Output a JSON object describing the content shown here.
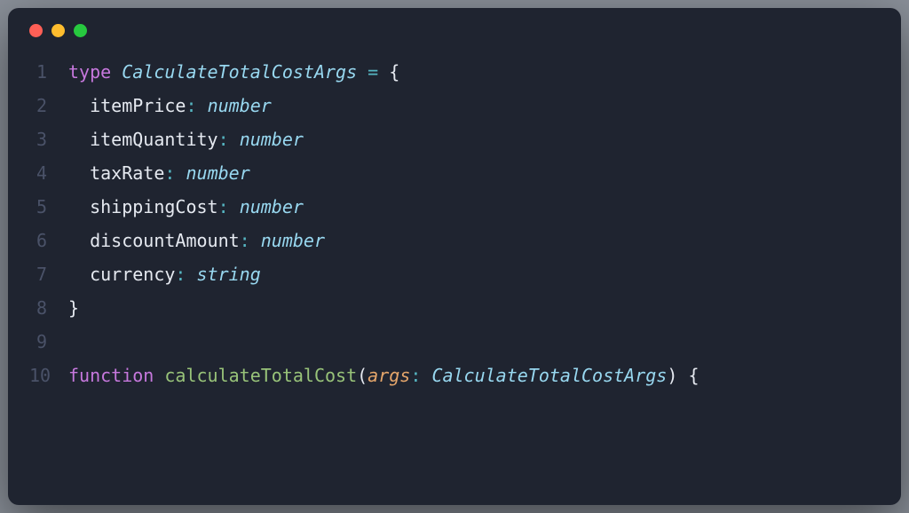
{
  "code": {
    "kw_type": "type",
    "type_name": "CalculateTotalCostArgs",
    "eq": " = ",
    "lbrace": "{",
    "rbrace": "}",
    "colon": ":",
    "comma": ",",
    "lparen": "(",
    "rparen": ")",
    "kw_function": "function",
    "fn_name": "calculateTotalCost",
    "param_name": "args",
    "props": {
      "p1": "itemPrice",
      "p2": "itemQuantity",
      "p3": "taxRate",
      "p4": "shippingCost",
      "p5": "discountAmount",
      "p6": "currency"
    },
    "types": {
      "number": "number",
      "string": "string"
    },
    "line_numbers": {
      "l1": "1",
      "l2": "2",
      "l3": "3",
      "l4": "4",
      "l5": "5",
      "l6": "6",
      "l7": "7",
      "l8": "8",
      "l9": "9",
      "l10": "10"
    }
  }
}
